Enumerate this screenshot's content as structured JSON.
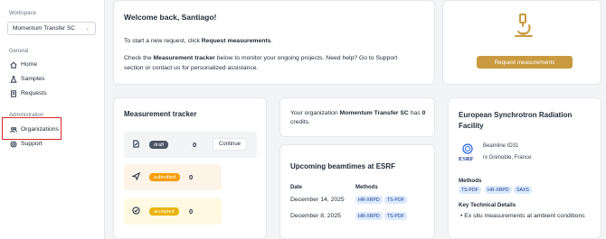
{
  "sidebar": {
    "workspace_label": "Workspace",
    "workspace_value": "Momentum Transfer SC",
    "general_label": "General",
    "nav": [
      {
        "label": "Home",
        "icon": "home-icon"
      },
      {
        "label": "Samples",
        "icon": "flask-icon"
      },
      {
        "label": "Requests",
        "icon": "document-icon"
      }
    ],
    "admin_label": "Administration",
    "admin_nav": [
      {
        "label": "Organizations",
        "icon": "users-icon"
      },
      {
        "label": "Support",
        "icon": "lifebuoy-icon"
      }
    ]
  },
  "welcome": {
    "title": "Welcome back, Santiago!",
    "line1_pre": "To start a new request, click ",
    "line1_bold": "Request measurements",
    "line1_post": ".",
    "line2_pre": "Check the ",
    "line2_bold": "Measurement tracker",
    "line2_post": " below to monitor your ongoing projects. Need help? Go to Support",
    "line3": "section or contact us for personalized assistance."
  },
  "request_card": {
    "button_label": "Request measurements",
    "accent": "#c99a3f"
  },
  "tracker": {
    "title": "Measurement tracker",
    "statuses": [
      {
        "label": "draft",
        "count": "0",
        "action": "Continue"
      },
      {
        "label": "submitted",
        "count": "0"
      },
      {
        "label": "accepted",
        "count": "0"
      }
    ]
  },
  "credits": {
    "pre": "Your organization ",
    "org": "Momentum Transfer SC",
    "mid": " has ",
    "credits": "0",
    "post": " credits."
  },
  "beamtimes": {
    "title": "Upcoming beamtimes at ESRF",
    "col_date": "Date",
    "col_methods": "Methods",
    "rows": [
      {
        "date": "December 14, 2025",
        "methods": [
          "HR-XRPD",
          "TS-PDF"
        ]
      },
      {
        "date": "December 8, 2025",
        "methods": [
          "HR-XRPD",
          "TS-PDF"
        ]
      }
    ]
  },
  "facility": {
    "title": "European Synchrotron Radiation Facility",
    "logo_text": "ESRF",
    "beamline": "Beamline ID31",
    "location": "rx Grenoble, France",
    "methods_label": "Methods",
    "methods": [
      "TS-PDF",
      "HR-XRPD",
      "SAXS"
    ],
    "tech_label": "Key Technical Details",
    "tech_item": "Ex situ measurements at ambient conditions"
  }
}
